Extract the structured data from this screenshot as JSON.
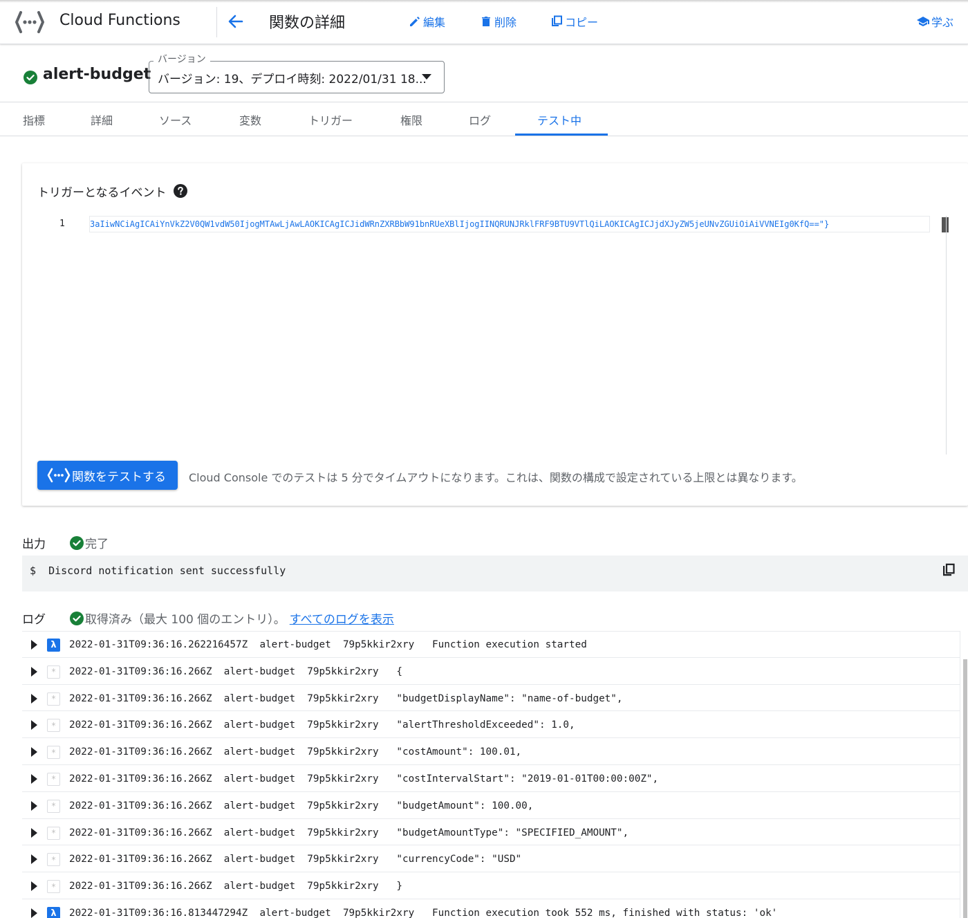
{
  "header": {
    "product_name": "Cloud Functions",
    "page_title": "関数の詳細",
    "actions": {
      "edit_label": "編集",
      "delete_label": "削除",
      "copy_label": "コピー",
      "learn_label": "学ぶ"
    }
  },
  "function": {
    "name": "alert-budget",
    "status": "active",
    "version_legend": "バージョン",
    "version_value": "バージョン: 19、デプロイ時刻: 2022/01/31 18..."
  },
  "tabs": [
    {
      "label": "指標",
      "active": false
    },
    {
      "label": "詳細",
      "active": false
    },
    {
      "label": "ソース",
      "active": false
    },
    {
      "label": "変数",
      "active": false
    },
    {
      "label": "トリガー",
      "active": false
    },
    {
      "label": "権限",
      "active": false
    },
    {
      "label": "ログ",
      "active": false
    },
    {
      "label": "テスト中",
      "active": true
    }
  ],
  "test": {
    "event_title": "トリガーとなるイベント",
    "line_number": "1",
    "code": "3aIiwNCiAgICAiYnVkZ2V0QW1vdW50IjogMTAwLjAwLAOKICAgICJidWRnZXRBbW91bnRUeXBlIjogIINQRUNJRklFRF9BTU9VTlQiLAOKICAgICJjdXJyZW5jeUNvZGUiOiAiVVNEIg0KfQ==\"}",
    "button_label": "関数をテストする",
    "timeout_note": "Cloud Console でのテストは 5 分でタイムアウトになります。これは、関数の構成で設定されている上限とは異なります。"
  },
  "output": {
    "label": "出力",
    "status": "完了",
    "text": "$  Discord notification sent successfully"
  },
  "logs": {
    "label": "ログ",
    "status": "取得済み（最大 100 個のエントリ）。",
    "link_label": "すべてのログを表示",
    "rows": [
      {
        "severity": "λ",
        "type": "lambda",
        "text": "2022-01-31T09:36:16.262216457Z  alert-budget  79p5kkir2xry   Function execution started"
      },
      {
        "severity": "*",
        "type": "default",
        "text": "2022-01-31T09:36:16.266Z  alert-budget  79p5kkir2xry   {"
      },
      {
        "severity": "*",
        "type": "default",
        "text": "2022-01-31T09:36:16.266Z  alert-budget  79p5kkir2xry   \"budgetDisplayName\": \"name-of-budget\","
      },
      {
        "severity": "*",
        "type": "default",
        "text": "2022-01-31T09:36:16.266Z  alert-budget  79p5kkir2xry   \"alertThresholdExceeded\": 1.0,"
      },
      {
        "severity": "*",
        "type": "default",
        "text": "2022-01-31T09:36:16.266Z  alert-budget  79p5kkir2xry   \"costAmount\": 100.01,"
      },
      {
        "severity": "*",
        "type": "default",
        "text": "2022-01-31T09:36:16.266Z  alert-budget  79p5kkir2xry   \"costIntervalStart\": \"2019-01-01T00:00:00Z\","
      },
      {
        "severity": "*",
        "type": "default",
        "text": "2022-01-31T09:36:16.266Z  alert-budget  79p5kkir2xry   \"budgetAmount\": 100.00,"
      },
      {
        "severity": "*",
        "type": "default",
        "text": "2022-01-31T09:36:16.266Z  alert-budget  79p5kkir2xry   \"budgetAmountType\": \"SPECIFIED_AMOUNT\","
      },
      {
        "severity": "*",
        "type": "default",
        "text": "2022-01-31T09:36:16.266Z  alert-budget  79p5kkir2xry   \"currencyCode\": \"USD\""
      },
      {
        "severity": "*",
        "type": "default",
        "text": "2022-01-31T09:36:16.266Z  alert-budget  79p5kkir2xry   }"
      },
      {
        "severity": "λ",
        "type": "lambda",
        "text": "2022-01-31T09:36:16.813447294Z  alert-budget  79p5kkir2xry   Function execution took 552 ms, finished with status: 'ok'"
      }
    ]
  },
  "colors": {
    "accent": "#1a73e8",
    "success": "#188038",
    "text": "#202124",
    "muted": "#5f6368"
  }
}
